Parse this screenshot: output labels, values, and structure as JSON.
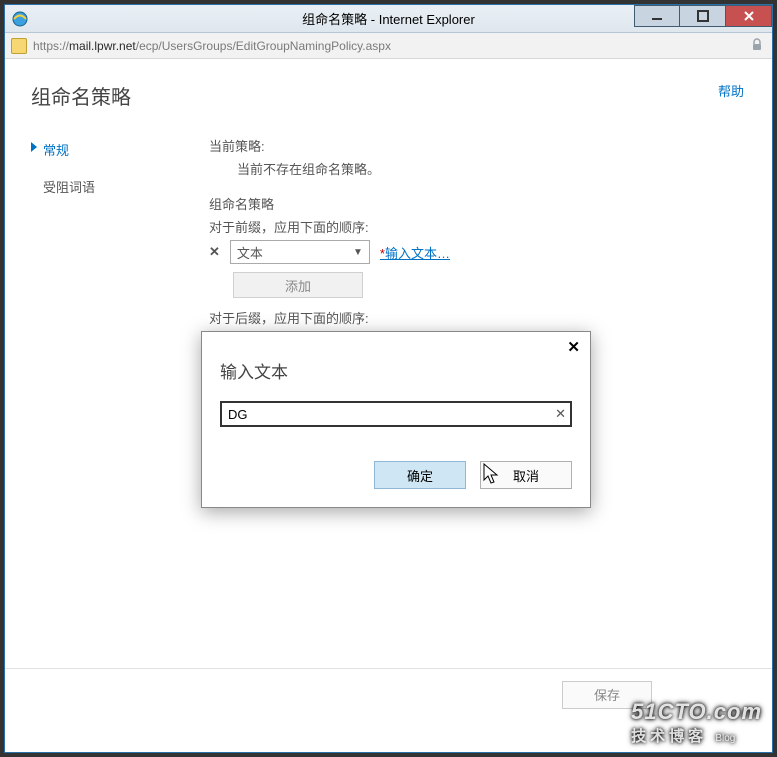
{
  "window": {
    "title": "组命名策略 - Internet Explorer",
    "url_prefix": "https://",
    "url_host": "mail.lpwr.net",
    "url_path": "/ecp/UsersGroups/EditGroupNamingPolicy.aspx"
  },
  "page": {
    "title": "组命名策略",
    "help": "帮助"
  },
  "sidebar": {
    "items": [
      {
        "label": "常规",
        "selected": true
      },
      {
        "label": "受阻词语",
        "selected": false
      }
    ]
  },
  "content": {
    "current_policy_label": "当前策略:",
    "current_policy_value": "当前不存在组命名策略。",
    "policy_section": "组命名策略",
    "prefix_label": "对于前缀，应用下面的顺序:",
    "dropdown_value": "文本",
    "input_text_link": "输入文本…",
    "add_button": "添加",
    "suffix_label": "对于后缀，应用下面的顺序:"
  },
  "footer": {
    "save": "保存"
  },
  "modal": {
    "title": "输入文本",
    "value": "DG",
    "ok": "确定",
    "cancel": "取消"
  },
  "watermark": {
    "top": "51CTO.com",
    "bot": "技术博客",
    "tag": "Blog"
  }
}
